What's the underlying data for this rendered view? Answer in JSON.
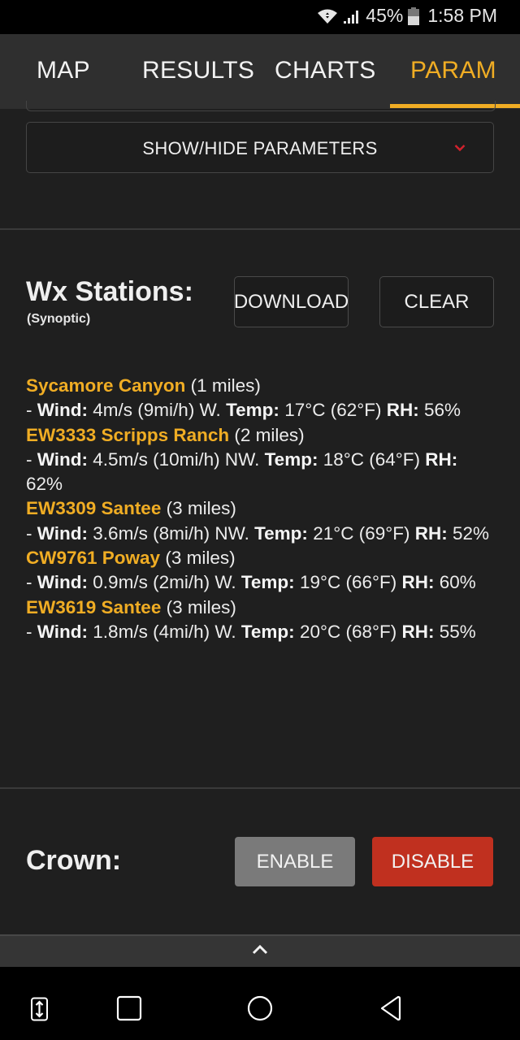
{
  "status_bar": {
    "icons": [
      "wifi-icon",
      "signal-icon",
      "battery-icon"
    ],
    "battery": "45%",
    "time": "1:58 PM"
  },
  "tabs": [
    {
      "label": "MAP",
      "active": false
    },
    {
      "label": "RESULTS",
      "active": false
    },
    {
      "label": "CHARTS",
      "active": false
    },
    {
      "label": "PARAM",
      "active": true
    }
  ],
  "show_hide": {
    "label": "SHOW/HIDE PARAMETERS",
    "icon": "chevron-down-icon"
  },
  "wx_stations": {
    "title": "Wx Stations:",
    "subtitle": "(Synoptic)",
    "download_label": "DOWNLOAD",
    "clear_label": "CLEAR",
    "field_labels": {
      "wind": "Wind:",
      "temp": "Temp:",
      "rh": "RH:"
    },
    "stations": [
      {
        "name": "Sycamore Canyon",
        "distance": "(1 miles)",
        "wind": "4m/s (9mi/h) W.",
        "temp": "17°C (62°F)",
        "rh": "56%"
      },
      {
        "name": "EW3333 Scripps Ranch",
        "distance": "(2 miles)",
        "wind": "4.5m/s (10mi/h) NW.",
        "temp": "18°C (64°F)",
        "rh": "62%"
      },
      {
        "name": "EW3309 Santee",
        "distance": "(3 miles)",
        "wind": "3.6m/s (8mi/h) NW.",
        "temp": "21°C (69°F)",
        "rh": "52%"
      },
      {
        "name": "CW9761 Poway",
        "distance": "(3 miles)",
        "wind": "0.9m/s (2mi/h) W.",
        "temp": "19°C (66°F)",
        "rh": "60%"
      },
      {
        "name": "EW3619 Santee",
        "distance": "(3 miles)",
        "wind": "1.8m/s (4mi/h) W.",
        "temp": "20°C (68°F)",
        "rh": "55%"
      }
    ]
  },
  "crown": {
    "title": "Crown:",
    "enable_label": "ENABLE",
    "disable_label": "DISABLE",
    "selected": "DISABLE"
  },
  "colors": {
    "accent": "#f0ad24",
    "disable_active": "#c0301f",
    "enable_inactive": "#7a7a7a",
    "chevron": "#d2222d"
  },
  "nav_bar": {
    "icons": [
      "screen-swap-icon",
      "recents-icon",
      "home-icon",
      "back-icon"
    ]
  },
  "bottom_toggle": {
    "icon": "chevron-up-icon"
  }
}
